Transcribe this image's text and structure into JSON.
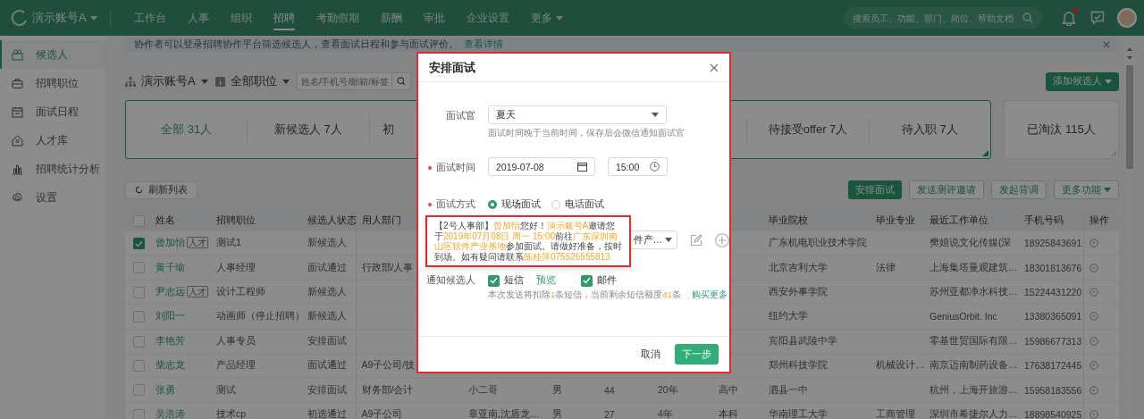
{
  "topbar": {
    "account": "演示账号A",
    "unread": true,
    "nav": [
      {
        "label": "工作台",
        "selected": false,
        "dropdown": false
      },
      {
        "label": "人事",
        "selected": false,
        "dropdown": false
      },
      {
        "label": "组织",
        "selected": false,
        "dropdown": false
      },
      {
        "label": "招聘",
        "selected": true,
        "dropdown": false
      },
      {
        "label": "考勤假期",
        "selected": false,
        "dropdown": false
      },
      {
        "label": "薪酬",
        "selected": false,
        "dropdown": false
      },
      {
        "label": "审批",
        "selected": false,
        "dropdown": false
      },
      {
        "label": "企业设置",
        "selected": false,
        "dropdown": false
      },
      {
        "label": "更多",
        "selected": false,
        "dropdown": true
      }
    ],
    "search": {
      "placeholder": "搜索员工、功能、部门、岗位、帮助文档"
    }
  },
  "sidebar": {
    "items": [
      {
        "label": "候选人",
        "selected": true
      },
      {
        "label": "招聘职位",
        "selected": false
      },
      {
        "label": "面试日程",
        "selected": false
      },
      {
        "label": "人才库",
        "selected": false
      },
      {
        "label": "招聘统计分析",
        "selected": false
      },
      {
        "label": "设置",
        "selected": false
      }
    ]
  },
  "notice": {
    "text": "协作者可以登录招聘协作平台筛选候选人，查看面试日程和参与面试评价。",
    "link": "查看详情"
  },
  "filters": {
    "organization": "演示账号A",
    "position": "全部职位",
    "search": {
      "placeholder": "姓名/手机号/邮箱/标签"
    },
    "add_button": "添加候选人"
  },
  "stages": [
    {
      "label": "全部 31人",
      "selected": true
    },
    {
      "label": "新候选人 7人",
      "selected": false
    },
    {
      "label": "初",
      "selected": false
    }
  ],
  "stages_more": [
    {
      "label": "待接受offer 7人",
      "selected": false
    },
    {
      "label": "待入职 7人",
      "selected": false
    }
  ],
  "eliminated": {
    "label": "已淘汰 115人",
    "selected": false
  },
  "toolbar": {
    "refresh": "刷新列表",
    "actions": [
      {
        "label": "安排面试",
        "primary": true,
        "dropdown": false
      },
      {
        "label": "发送测评邀请",
        "primary": false,
        "dropdown": false
      },
      {
        "label": "发起背调",
        "primary": false,
        "dropdown": false
      },
      {
        "label": "更多功能",
        "primary": false,
        "dropdown": true
      }
    ]
  },
  "table": {
    "all_checked": false,
    "columns": [
      "姓名",
      "招聘职位",
      "候选人状态",
      "用人部门",
      null,
      null,
      null,
      null,
      null,
      "毕业院校",
      "毕业专业",
      "最近工作单位",
      "手机号码",
      "操作"
    ],
    "rows": [
      {
        "checked": true,
        "tag": "人才",
        "cells": [
          "曾加怡",
          "测试1",
          "新候选人",
          null,
          null,
          null,
          null,
          null,
          null,
          "广东机电职业技术学院",
          null,
          "樊姐说文化传媒(深",
          "18925843691"
        ]
      },
      {
        "checked": false,
        "cells": [
          "黄千瑜",
          "人事经理",
          "面试通过",
          "行政部/人事",
          null,
          null,
          null,
          null,
          null,
          "北京吉利大学",
          "法律",
          "上海集塔曼观建筑…",
          "18301813676"
        ]
      },
      {
        "checked": false,
        "tag": "人才",
        "cells": [
          "尹志远",
          "设计工程师",
          "新候选人",
          null,
          null,
          null,
          null,
          null,
          null,
          "西安外事学院",
          null,
          "苏州亚都净水科技…",
          "15224431220"
        ]
      },
      {
        "checked": false,
        "cells": [
          "刘阳一",
          "动画师（停止招聘）",
          "新候选人",
          null,
          null,
          null,
          null,
          null,
          null,
          "纽约大学",
          null,
          "GeniusOrbit. Inc",
          "13380365091"
        ]
      },
      {
        "checked": false,
        "cells": [
          "李艳芳",
          "人事专员",
          "安排面试",
          null,
          null,
          null,
          null,
          null,
          null,
          "宾阳县武陵中学",
          null,
          "零基世贸国际有限…",
          "15986677313"
        ]
      },
      {
        "checked": false,
        "cells": [
          "柴志龙",
          "产品经理",
          "面试通过",
          "A9子公司/技",
          null,
          null,
          null,
          null,
          null,
          "郑州科技学院",
          "机械设计…",
          "南京迈南制药设备…",
          "17638172445"
        ]
      },
      {
        "checked": false,
        "cells": [
          "张勇",
          "测试",
          "安排面试",
          "财务部/会计",
          "小二哥",
          "男",
          "44",
          "20年",
          "高中",
          "泗县一中",
          null,
          "杭州，上海开旅游…",
          "15958183556"
        ]
      },
      {
        "checked": false,
        "cells": [
          "吴浩涛",
          "技术cp",
          "初选通过",
          "A9子公司",
          "章亚南,沈盾龙…",
          "男",
          "27",
          "4年",
          "本科",
          "华南理工大学",
          "工商管理",
          "深圳市希捷尔人力…",
          "18898540925"
        ]
      }
    ]
  },
  "modal": {
    "title": "安排面试",
    "interviewer": {
      "label": "面试官",
      "value": "夏天",
      "hint": "面试时间晚于当前时间，保存后会微信通知面试官"
    },
    "time": {
      "label": "面试时间",
      "required": true,
      "date": "2019-07-08",
      "clock": "15:00"
    },
    "method": {
      "label": "面试方式",
      "required": true,
      "options": [
        {
          "label": "现场面试",
          "selected": true
        },
        {
          "label": "电话面试",
          "selected": false
        }
      ]
    },
    "location": {
      "value": "件产…"
    },
    "message": {
      "segments": [
        {
          "text": "【2号人事部】",
          "highlight": false
        },
        {
          "text": "曾加怡",
          "highlight": true
        },
        {
          "text": "您好！",
          "highlight": false
        },
        {
          "text": "演示账号A",
          "highlight": true
        },
        {
          "text": "邀请您于",
          "highlight": false
        },
        {
          "text": "2019年07月08日 周一 15:00",
          "highlight": true
        },
        {
          "text": "前往",
          "highlight": false
        },
        {
          "text": "广东深圳南山区软件产业基地",
          "highlight": true
        },
        {
          "text": "参加面试。请做好准备，按时到场。如有疑问请联系",
          "highlight": false
        },
        {
          "text": "陈桂萍075526555813",
          "highlight": true
        }
      ]
    },
    "notify": {
      "label": "通知候选人",
      "sms": {
        "label": "短信",
        "checked": true
      },
      "preview": "预览",
      "email": {
        "label": "邮件",
        "checked": true
      },
      "note": [
        {
          "text": "本次发送将扣除",
          "highlight": false
        },
        {
          "text": "1",
          "highlight": true
        },
        {
          "text": "条短信，当前剩余短信额度",
          "highlight": false
        },
        {
          "text": "41",
          "highlight": true
        },
        {
          "text": "条",
          "highlight": false
        }
      ],
      "buy": "购买更多"
    },
    "cancel": "取消",
    "next": "下一步"
  }
}
